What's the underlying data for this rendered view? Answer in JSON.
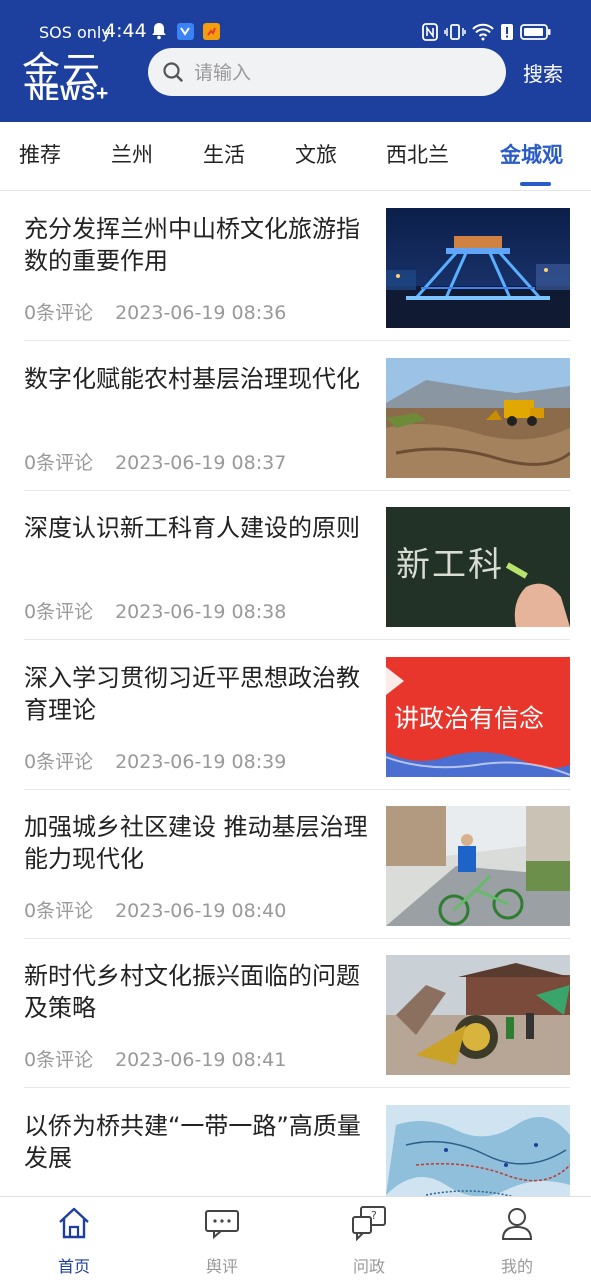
{
  "status_bar": {
    "carrier": "SOS only",
    "time": "4:44"
  },
  "header": {
    "logo_cn": "金云",
    "logo_en": "NEWS+",
    "search_placeholder": "请输入",
    "search_button": "搜索"
  },
  "tabs": [
    {
      "label": "推荐"
    },
    {
      "label": "兰州"
    },
    {
      "label": "生活"
    },
    {
      "label": "文旅"
    },
    {
      "label": "西北兰"
    },
    {
      "label": "金城观"
    }
  ],
  "news": [
    {
      "title": "充分发挥兰州中山桥文化旅游指数的重要作用",
      "comments": "0条评论",
      "time": "2023-06-19 08:36"
    },
    {
      "title": "数字化赋能农村基层治理现代化",
      "comments": "0条评论",
      "time": "2023-06-19 08:37"
    },
    {
      "title": "深度认识新工科育人建设的原则",
      "comments": "0条评论",
      "time": "2023-06-19 08:38"
    },
    {
      "title": "深入学习贯彻习近平思想政治教育理论",
      "comments": "0条评论",
      "time": "2023-06-19 08:39"
    },
    {
      "title": "加强城乡社区建设 推动基层治理能力现代化",
      "comments": "0条评论",
      "time": "2023-06-19 08:40"
    },
    {
      "title": "新时代乡村文化振兴面临的问题及策略",
      "comments": "0条评论",
      "time": "2023-06-19 08:41"
    },
    {
      "title": "以侨为桥共建“一带一路”高质量发展",
      "comments": "",
      "time": ""
    }
  ],
  "thumb_text": {
    "chalkboard": "新工科",
    "banner": "讲政治有信念"
  },
  "bottom_nav": [
    {
      "label": "首页",
      "icon": "home-icon"
    },
    {
      "label": "舆评",
      "icon": "chat-icon"
    },
    {
      "label": "问政",
      "icon": "question-chat-icon"
    },
    {
      "label": "我的",
      "icon": "user-icon"
    }
  ],
  "colors": {
    "brand": "#1d3f9e",
    "accent": "#2a5cc7",
    "muted": "#999999"
  }
}
